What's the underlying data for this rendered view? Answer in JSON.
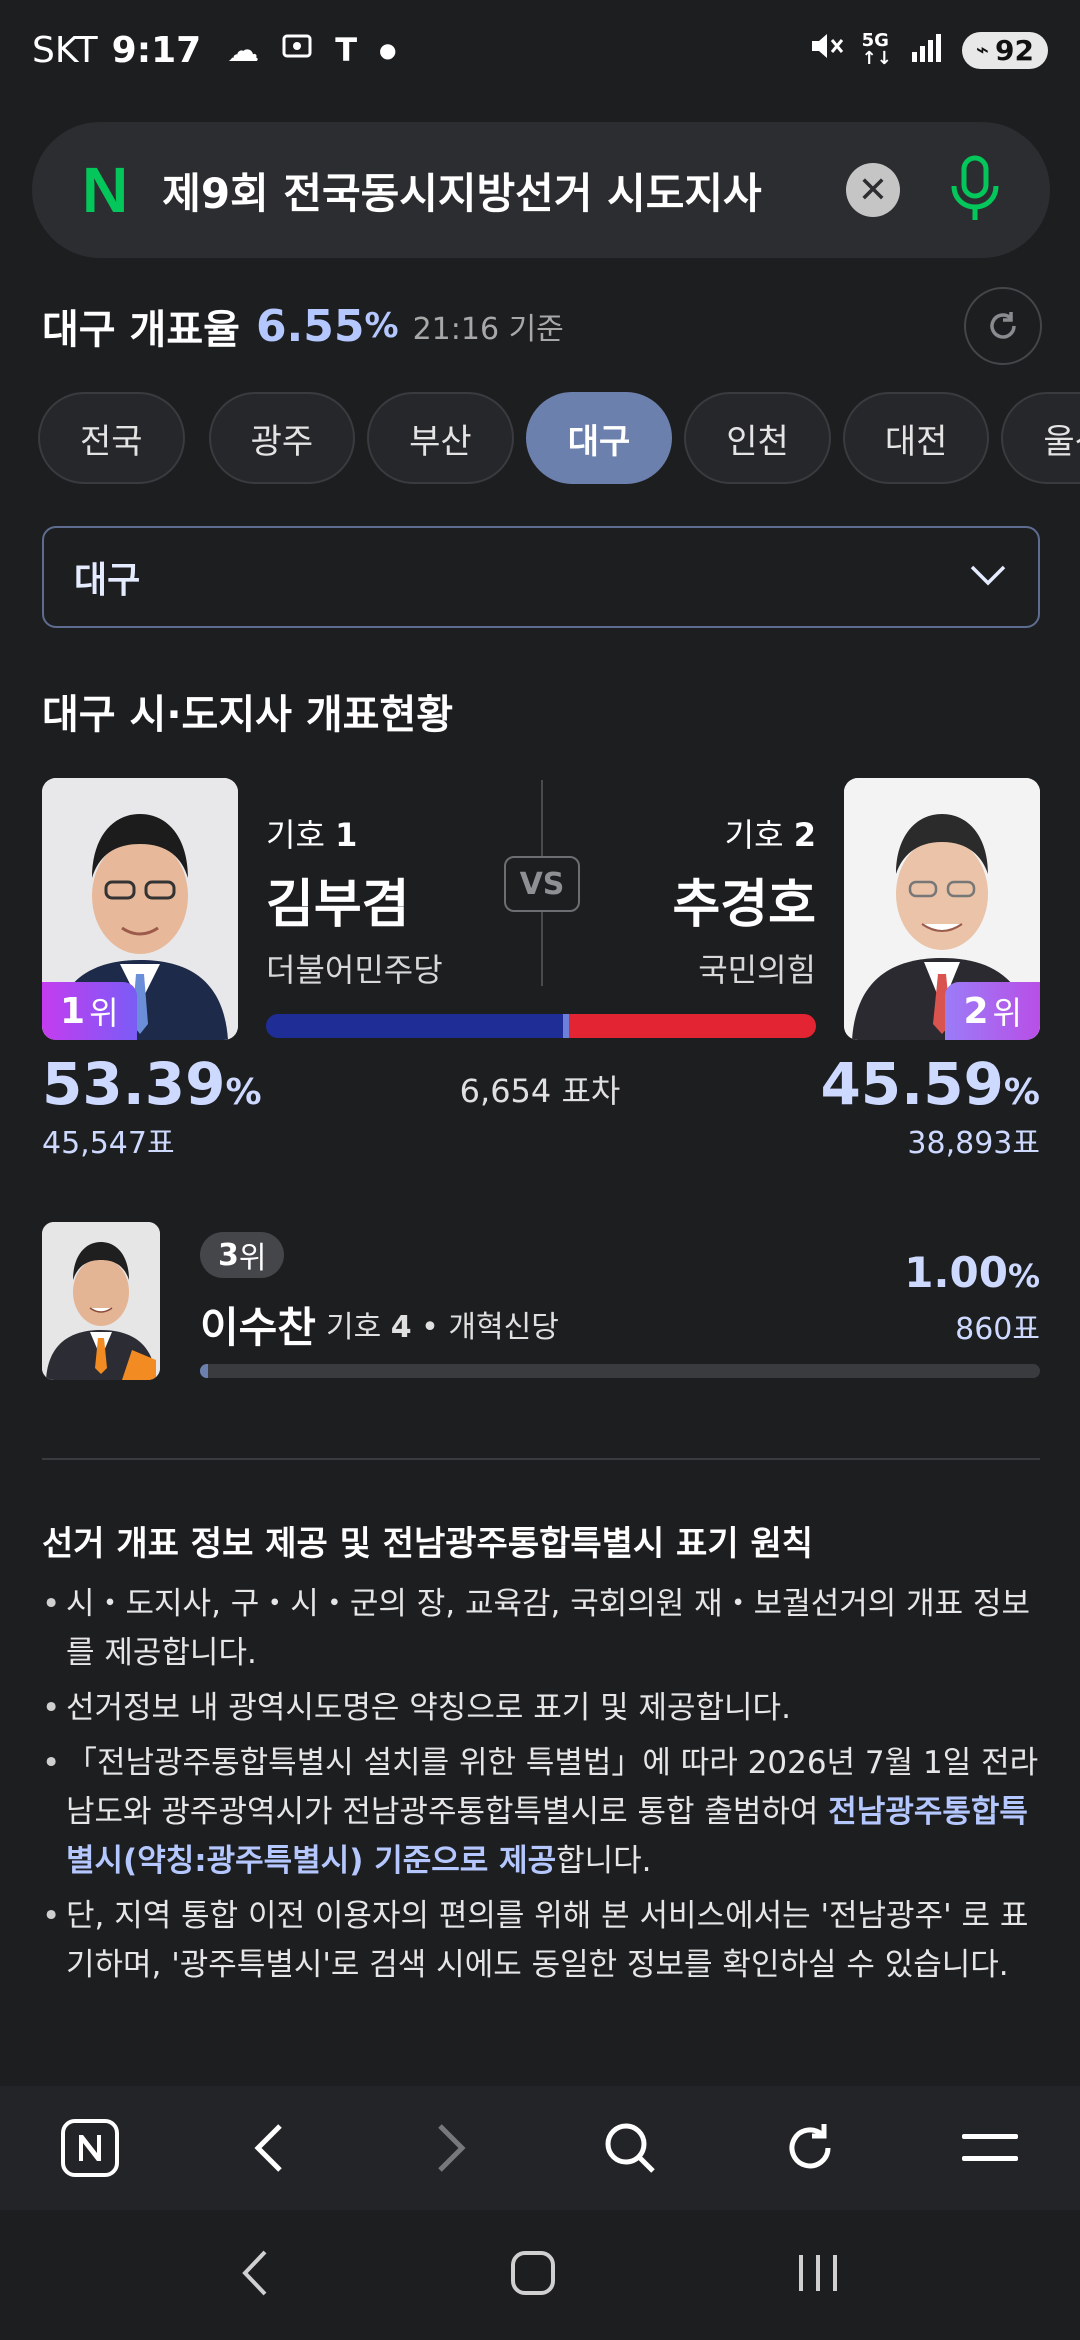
{
  "status_bar": {
    "carrier": "SKT",
    "time": "9:17",
    "battery": "92"
  },
  "search": {
    "logo": "N",
    "query": "제9회 전국동시지방선거 시도지사"
  },
  "header": {
    "title": "대구 개표율",
    "rate": "6.55",
    "rate_unit": "%",
    "time": "21:16 기준"
  },
  "regions": [
    "전국",
    "광주",
    "부산",
    "대구",
    "인천",
    "대전",
    "울산"
  ],
  "active_region": "대구",
  "dropdown": {
    "label": "대구"
  },
  "section_title": "대구 시·도지사 개표현황",
  "vs_label": "VS",
  "gap_text": "6,654 표차",
  "candidates": [
    {
      "rank_num": "1",
      "rank_suffix": "위",
      "number_label": "기호",
      "number": "1",
      "name": "김부겸",
      "party": "더불어민주당",
      "percent": "53.39",
      "unit": "%",
      "votes": "45,547표",
      "color": "#1f2e96"
    },
    {
      "rank_num": "2",
      "rank_suffix": "위",
      "number_label": "기호",
      "number": "2",
      "name": "추경호",
      "party": "국민의힘",
      "percent": "45.59",
      "unit": "%",
      "votes": "38,893표",
      "color": "#e32533"
    }
  ],
  "third": {
    "rank_num": "3",
    "rank_suffix": "위",
    "name": "이수찬",
    "number_label": "기호",
    "number": "4",
    "party": "개혁신당",
    "percent": "1.00",
    "unit": "%",
    "votes": "860표"
  },
  "notice": {
    "title": "선거 개표 정보 제공 및 전남광주통합특별시 표기 원칙",
    "items": [
      {
        "text": "시・도지사, 구・시・군의 장, 교육감, 국회의원 재・보궐선거의 개표 정보를 제공합니다."
      },
      {
        "text": "선거정보 내 광역시도명은 약칭으로 표기 및 제공합니다."
      },
      {
        "text_a": "「전남광주통합특별시 설치를 위한 특별법」에 따라 2026년 7월 1일 전라남도와 광주광역시가 전남광주통합특별시로 통합 출범하여 ",
        "highlight": "전남광주통합특별시(약칭:광주특별시) 기준으로 제공",
        "text_b": "합니다."
      },
      {
        "text": "단, 지역 통합 이전 이용자의 편의를 위해 본 서비스에서는 '전남광주' 로 표기하며, '광주특별시'로 검색 시에도 동일한 정보를 확인하실 수 있습니다."
      }
    ]
  },
  "icons": {
    "statusbar": [
      "cloud-icon",
      "screen-capture-icon",
      "t-icon",
      "dot-icon",
      "mute-icon",
      "5g-icon",
      "signal-icon",
      "battery-icon"
    ],
    "browser": [
      "naver-home-icon",
      "back-icon",
      "forward-icon",
      "search-icon",
      "reload-icon",
      "menu-icon"
    ],
    "system": [
      "back-nav-icon",
      "home-nav-icon",
      "recents-nav-icon"
    ]
  }
}
